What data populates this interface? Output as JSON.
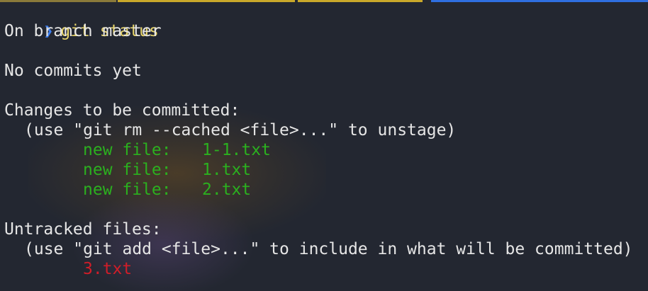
{
  "colors": {
    "background": "#232731",
    "text": "#e6e6e6",
    "prompt": "#3d7ff0",
    "command": "#e8d56a",
    "staged": "#2bb01f",
    "untracked": "#d11d28"
  },
  "prompt": {
    "icon": "chevron-right-icon",
    "symbol": "❯",
    "command": "git status"
  },
  "output": {
    "branch_line": "On branch master",
    "no_commits": "No commits yet",
    "staged": {
      "header": "Changes to be committed:",
      "hint": "(use \"git rm --cached <file>...\" to unstage)",
      "files": [
        {
          "status": "new file:",
          "name": "1-1.txt"
        },
        {
          "status": "new file:",
          "name": "1.txt"
        },
        {
          "status": "new file:",
          "name": "2.txt"
        }
      ]
    },
    "untracked": {
      "header": "Untracked files:",
      "hint": "(use \"git add <file>...\" to include in what will be committed)",
      "files": [
        "3.txt"
      ]
    }
  }
}
